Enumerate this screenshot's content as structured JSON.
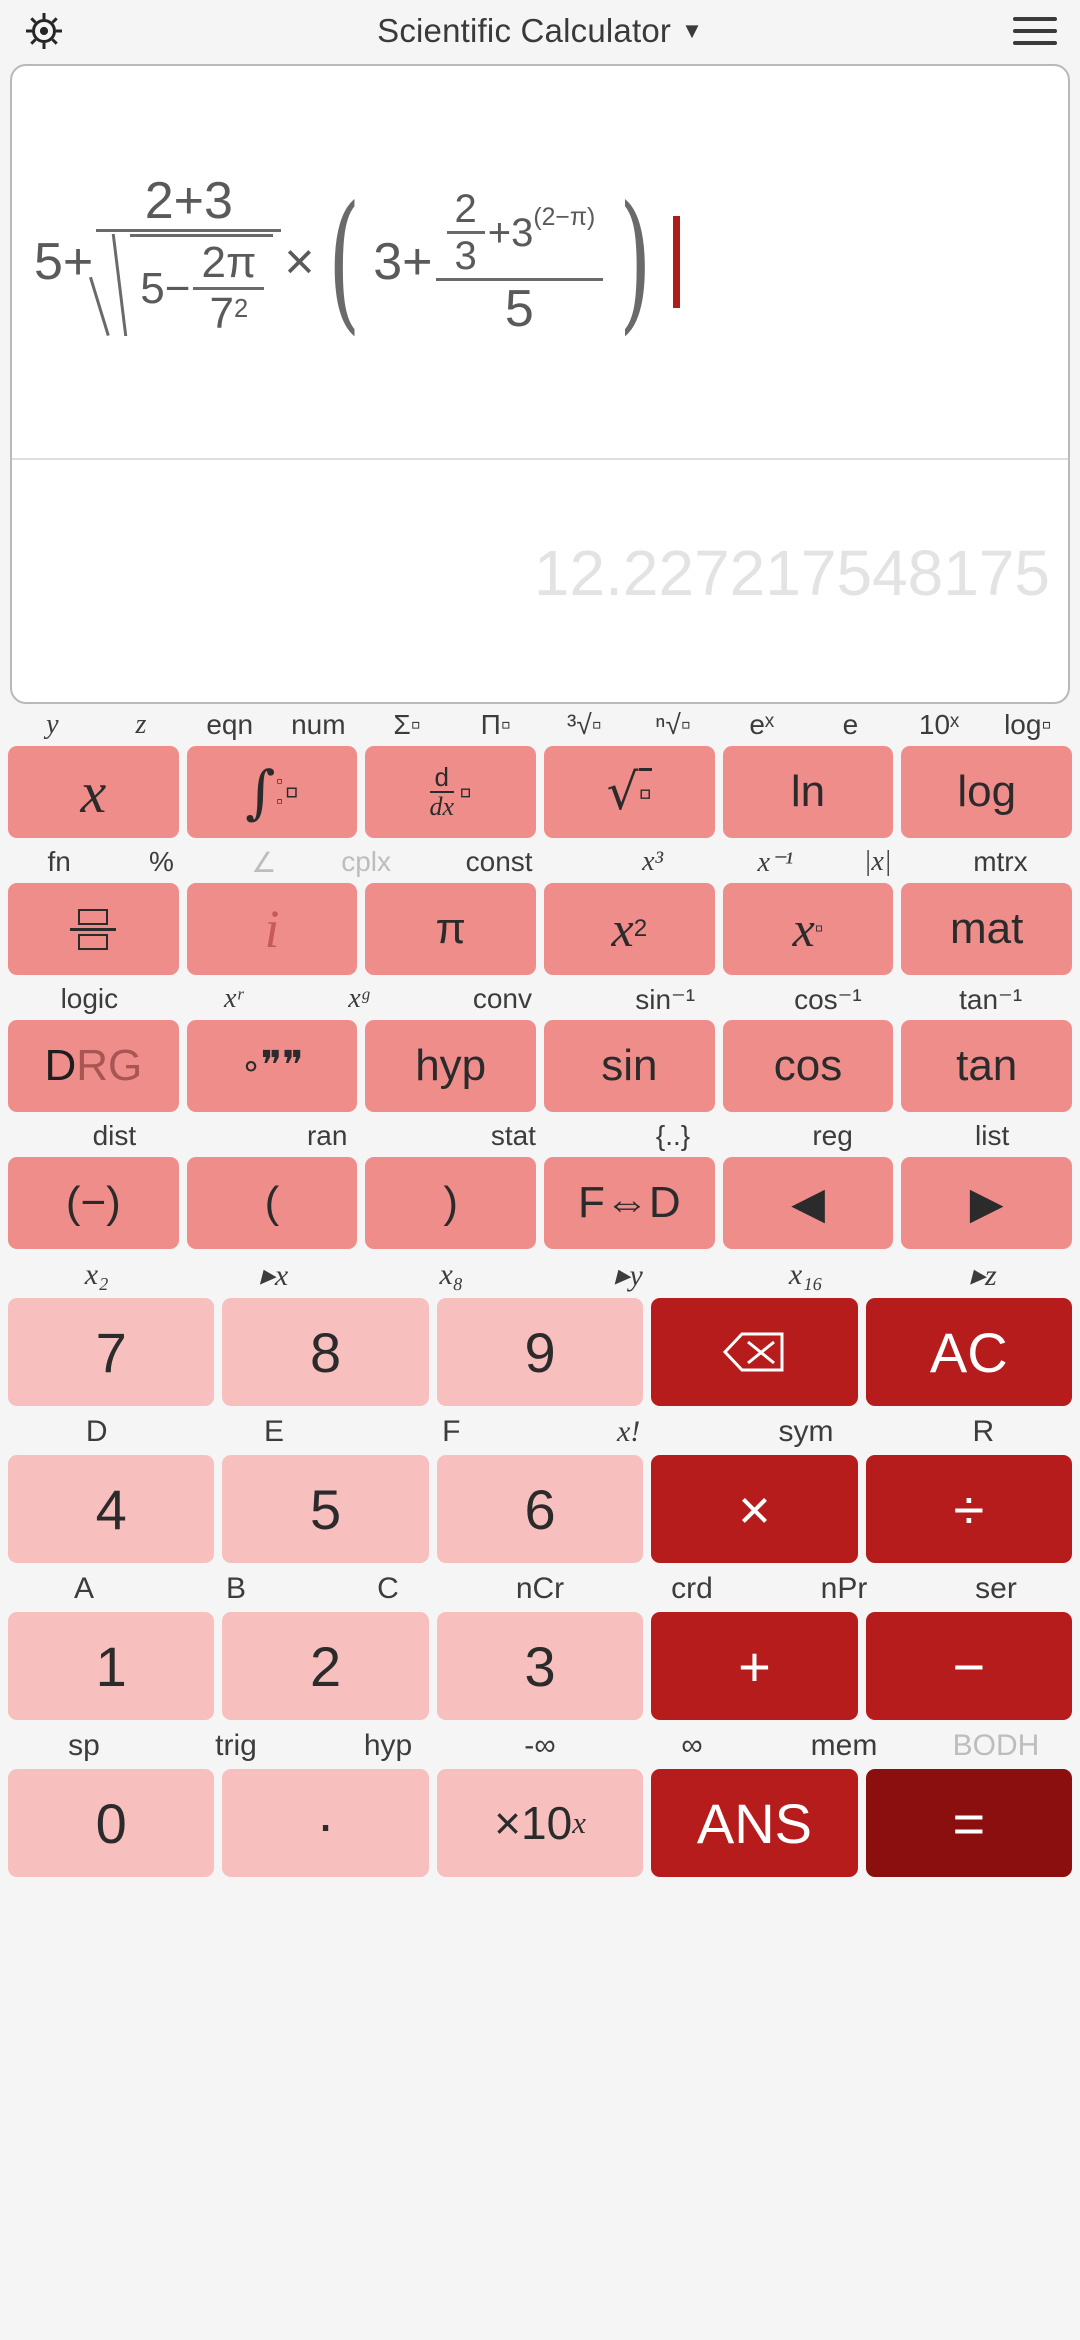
{
  "titlebar": {
    "gear_icon": "gear-icon",
    "title": "Scientific Calculator",
    "caret": "▼",
    "menu_icon": "hamburger-menu-icon"
  },
  "display": {
    "expression": {
      "text": "5+(2+3)/sqrt(5-2pi/7^2) x (3+(2/3+3^(2-pi))/5)",
      "lead": "5+",
      "frac1_num": "2+3",
      "sqrt_inner_lead": "5−",
      "sqrt_frac_num": "2π",
      "sqrt_frac_den_base": "7",
      "sqrt_frac_den_exp": "2",
      "times": "×",
      "paren_open": "(",
      "paren_close": ")",
      "inner_lead": "3+",
      "inner_num_frac_num": "2",
      "inner_num_frac_den": "3",
      "inner_plus": "+3",
      "inner_exp": "(2−π)",
      "inner_den": "5"
    },
    "result": "12.227217548175"
  },
  "keypad": {
    "rows": [
      {
        "labels": [
          {
            "t": "y",
            "ital": true,
            "dim": false,
            "w": 1
          },
          {
            "t": "z",
            "ital": true,
            "dim": false,
            "w": 1
          },
          {
            "t": "eqn",
            "ital": false,
            "dim": false,
            "w": 1
          },
          {
            "t": "num",
            "ital": false,
            "dim": false,
            "w": 1
          },
          {
            "t": "Σ▫",
            "ital": false,
            "dim": false,
            "w": 1
          },
          {
            "t": "Π▫",
            "ital": false,
            "dim": false,
            "w": 1
          },
          {
            "t": "³√▫",
            "ital": false,
            "dim": false,
            "w": 1
          },
          {
            "t": "ⁿ√▫",
            "ital": false,
            "dim": false,
            "w": 1
          },
          {
            "t": "eˣ",
            "ital": false,
            "dim": false,
            "w": 1
          },
          {
            "t": "e",
            "ital": false,
            "dim": false,
            "w": 1
          },
          {
            "t": "10ˣ",
            "ital": false,
            "dim": false,
            "w": 1
          },
          {
            "t": "log▫",
            "ital": false,
            "dim": false,
            "w": 1
          }
        ],
        "keys": [
          {
            "t": "x",
            "cls": "fn",
            "style": "serif-i",
            "name": "key-variable-x"
          },
          {
            "t": "∫▫",
            "cls": "fn",
            "style": "integral",
            "name": "key-integral"
          },
          {
            "t": "d/dx",
            "cls": "fn",
            "style": "derivative",
            "name": "key-derivative"
          },
          {
            "t": "√▫",
            "cls": "fn",
            "style": "plain",
            "name": "key-square-root"
          },
          {
            "t": "ln",
            "cls": "fn",
            "style": "plain",
            "name": "key-ln"
          },
          {
            "t": "log",
            "cls": "fn",
            "style": "plain",
            "name": "key-log"
          }
        ]
      },
      {
        "labels": [
          {
            "t": "fn",
            "ital": false,
            "dim": false,
            "w": 1
          },
          {
            "t": "%",
            "ital": false,
            "dim": false,
            "w": 1
          },
          {
            "t": "∠",
            "ital": false,
            "dim": true,
            "w": 1
          },
          {
            "t": "cplx",
            "ital": false,
            "dim": true,
            "w": 1
          },
          {
            "t": "const",
            "ital": false,
            "dim": false,
            "w": 1.6
          },
          {
            "t": "x³",
            "ital": true,
            "dim": false,
            "w": 1.4
          },
          {
            "t": "x⁻¹",
            "ital": true,
            "dim": false,
            "w": 1
          },
          {
            "t": "|x|",
            "ital": true,
            "dim": false,
            "w": 1
          },
          {
            "t": "mtrx",
            "ital": false,
            "dim": false,
            "w": 1.4
          }
        ],
        "keys": [
          {
            "t": "▤",
            "cls": "fn",
            "style": "fraction-template",
            "name": "key-fraction"
          },
          {
            "t": "i",
            "cls": "fn",
            "style": "serif-i-light",
            "name": "key-imaginary-i"
          },
          {
            "t": "π",
            "cls": "fn",
            "style": "plain",
            "name": "key-pi"
          },
          {
            "t": "x²",
            "cls": "fn",
            "style": "sup",
            "name": "key-x-squared"
          },
          {
            "t": "x▫",
            "cls": "fn",
            "style": "sup-box",
            "name": "key-x-power"
          },
          {
            "t": "mat",
            "cls": "fn",
            "style": "plain",
            "name": "key-matrix"
          }
        ]
      },
      {
        "labels": [
          {
            "t": "logic",
            "ital": false,
            "dim": false,
            "w": 1.3
          },
          {
            "t": "xʳ",
            "ital": true,
            "dim": false,
            "w": 1
          },
          {
            "t": "xᵍ",
            "ital": true,
            "dim": false,
            "w": 1
          },
          {
            "t": "conv",
            "ital": false,
            "dim": false,
            "w": 1.3
          },
          {
            "t": "sin⁻¹",
            "ital": false,
            "dim": false,
            "w": 1.3
          },
          {
            "t": "cos⁻¹",
            "ital": false,
            "dim": false,
            "w": 1.3
          },
          {
            "t": "tan⁻¹",
            "ital": false,
            "dim": false,
            "w": 1.3
          }
        ],
        "keys": [
          {
            "t": "DRG",
            "cls": "fn",
            "style": "drg",
            "name": "key-drg"
          },
          {
            "t": "∘′″",
            "cls": "fn",
            "style": "dms",
            "name": "key-degrees-minutes-seconds"
          },
          {
            "t": "hyp",
            "cls": "fn",
            "style": "plain",
            "name": "key-hyp"
          },
          {
            "t": "sin",
            "cls": "fn",
            "style": "plain",
            "name": "key-sin"
          },
          {
            "t": "cos",
            "cls": "fn",
            "style": "plain",
            "name": "key-cos"
          },
          {
            "t": "tan",
            "cls": "fn",
            "style": "plain",
            "name": "key-tan"
          }
        ]
      },
      {
        "labels": [
          {
            "t": "dist",
            "ital": false,
            "dim": false,
            "w": 1.2
          },
          {
            "t": "ran",
            "ital": false,
            "dim": false,
            "w": 1.2
          },
          {
            "t": "stat",
            "ital": false,
            "dim": false,
            "w": 0.9
          },
          {
            "t": "{..}",
            "ital": false,
            "dim": false,
            "w": 0.9
          },
          {
            "t": "reg",
            "ital": false,
            "dim": false,
            "w": 0.9
          },
          {
            "t": "list",
            "ital": false,
            "dim": false,
            "w": 0.9
          }
        ],
        "keys": [
          {
            "t": "(−)",
            "cls": "fn",
            "style": "plain",
            "name": "key-negative"
          },
          {
            "t": "(",
            "cls": "fn",
            "style": "plain",
            "name": "key-paren-open"
          },
          {
            "t": ")",
            "cls": "fn",
            "style": "plain",
            "name": "key-paren-close"
          },
          {
            "t": "F⇔D",
            "cls": "fn",
            "style": "plain",
            "name": "key-fraction-decimal-toggle"
          },
          {
            "t": "◀",
            "cls": "fn",
            "style": "plain",
            "name": "key-cursor-left"
          },
          {
            "t": "▶",
            "cls": "fn",
            "style": "plain",
            "name": "key-cursor-right"
          }
        ]
      }
    ],
    "numpad": [
      {
        "labels": [
          {
            "t": "x₂",
            "ital": true,
            "dim": false
          },
          {
            "t": "▸x",
            "ital": true,
            "dim": false
          },
          {
            "t": "x₈",
            "ital": true,
            "dim": false
          },
          {
            "t": "▸y",
            "ital": true,
            "dim": false
          },
          {
            "t": "x₁₆",
            "ital": true,
            "dim": false
          },
          {
            "t": "▸z",
            "ital": true,
            "dim": false
          }
        ],
        "keys": [
          {
            "t": "7",
            "cls": "num",
            "name": "key-7"
          },
          {
            "t": "8",
            "cls": "num",
            "name": "key-8"
          },
          {
            "t": "9",
            "cls": "num",
            "name": "key-9"
          },
          {
            "t": "⌫",
            "cls": "op",
            "name": "key-backspace"
          },
          {
            "t": "AC",
            "cls": "op",
            "name": "key-all-clear"
          }
        ]
      },
      {
        "labels": [
          {
            "t": "D",
            "ital": false,
            "dim": false
          },
          {
            "t": "E",
            "ital": false,
            "dim": false
          },
          {
            "t": "F",
            "ital": false,
            "dim": false
          },
          {
            "t": "x!",
            "ital": true,
            "dim": false
          },
          {
            "t": "sym",
            "ital": false,
            "dim": false
          },
          {
            "t": "R",
            "ital": false,
            "dim": false
          }
        ],
        "keys": [
          {
            "t": "4",
            "cls": "num",
            "name": "key-4"
          },
          {
            "t": "5",
            "cls": "num",
            "name": "key-5"
          },
          {
            "t": "6",
            "cls": "num",
            "name": "key-6"
          },
          {
            "t": "×",
            "cls": "op",
            "name": "key-multiply"
          },
          {
            "t": "÷",
            "cls": "op",
            "name": "key-divide"
          }
        ]
      },
      {
        "labels": [
          {
            "t": "A",
            "ital": false,
            "dim": false
          },
          {
            "t": "B",
            "ital": false,
            "dim": false
          },
          {
            "t": "C",
            "ital": false,
            "dim": false
          },
          {
            "t": "nCr",
            "ital": false,
            "dim": false
          },
          {
            "t": "crd",
            "ital": false,
            "dim": false
          },
          {
            "t": "nPr",
            "ital": false,
            "dim": false
          },
          {
            "t": "ser",
            "ital": false,
            "dim": false
          }
        ],
        "keys": [
          {
            "t": "1",
            "cls": "num",
            "name": "key-1"
          },
          {
            "t": "2",
            "cls": "num",
            "name": "key-2"
          },
          {
            "t": "3",
            "cls": "num",
            "name": "key-3"
          },
          {
            "t": "+",
            "cls": "op",
            "name": "key-plus"
          },
          {
            "t": "−",
            "cls": "op",
            "name": "key-minus"
          }
        ]
      },
      {
        "labels": [
          {
            "t": "sp",
            "ital": false,
            "dim": false
          },
          {
            "t": "trig",
            "ital": false,
            "dim": false
          },
          {
            "t": "hyp",
            "ital": false,
            "dim": false
          },
          {
            "t": "-∞",
            "ital": false,
            "dim": false
          },
          {
            "t": "∞",
            "ital": false,
            "dim": false
          },
          {
            "t": "mem",
            "ital": false,
            "dim": false
          },
          {
            "t": "BODH",
            "ital": false,
            "dim": true
          }
        ],
        "keys": [
          {
            "t": "0",
            "cls": "num",
            "name": "key-0"
          },
          {
            "t": "·",
            "cls": "num",
            "name": "key-decimal-point"
          },
          {
            "t": "×10ˣ",
            "cls": "num",
            "name": "key-exponent"
          },
          {
            "t": "ANS",
            "cls": "op",
            "name": "key-answer"
          },
          {
            "t": "=",
            "cls": "eq",
            "name": "key-equals"
          }
        ]
      }
    ]
  },
  "colors": {
    "fn_key": "#ef8d8b",
    "num_key": "#f7bfbe",
    "op_key": "#b71c1c",
    "eq_key": "#8c0f0f",
    "cursor": "#b01c1c",
    "result_text": "#e3e3e3",
    "expression_text": "#5a5a5a"
  }
}
